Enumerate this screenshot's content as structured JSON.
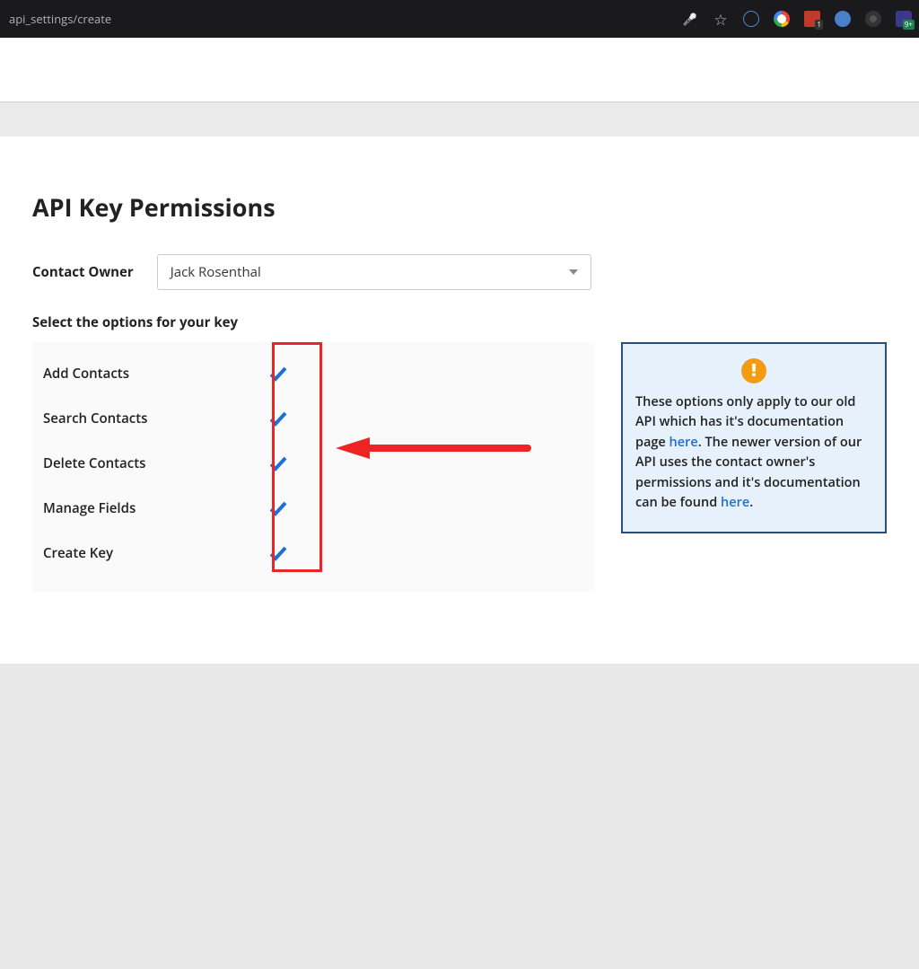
{
  "chrome": {
    "url_fragment": "api_settings/create"
  },
  "page": {
    "title": "API Key Permissions",
    "owner_label": "Contact Owner",
    "owner_value": "Jack Rosenthal",
    "options_label": "Select the options for your key"
  },
  "permissions": [
    {
      "label": "Add Contacts",
      "checked": true
    },
    {
      "label": "Search Contacts",
      "checked": true
    },
    {
      "label": "Delete Contacts",
      "checked": true
    },
    {
      "label": "Manage Fields",
      "checked": true
    },
    {
      "label": "Create Key",
      "checked": true
    }
  ],
  "info": {
    "text_a": "These options only apply to our old API which has it's documentation page ",
    "link_a": "here",
    "text_b": ". The newer version of our API uses the contact owner's permissions and it's documentation can be found ",
    "link_b": "here",
    "text_c": "."
  }
}
